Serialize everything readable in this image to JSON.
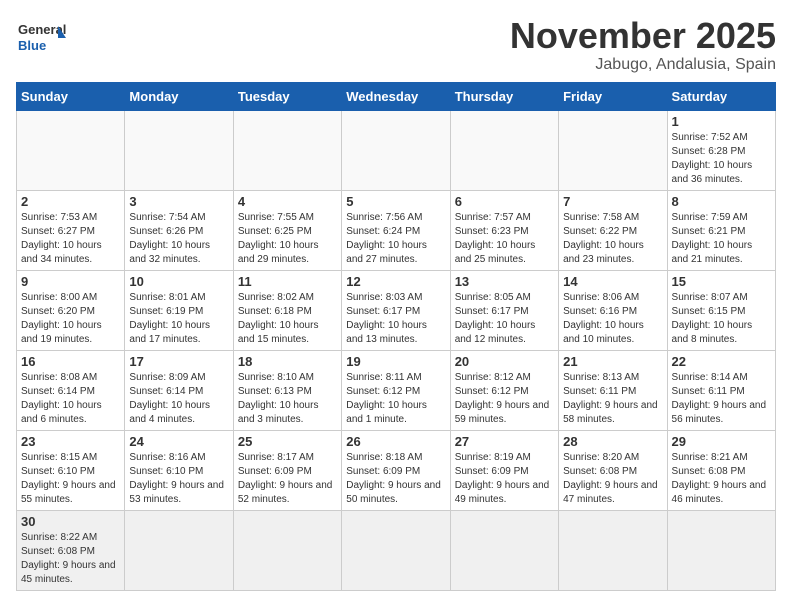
{
  "logo": {
    "general": "General",
    "blue": "Blue"
  },
  "title": "November 2025",
  "subtitle": "Jabugo, Andalusia, Spain",
  "days_header": [
    "Sunday",
    "Monday",
    "Tuesday",
    "Wednesday",
    "Thursday",
    "Friday",
    "Saturday"
  ],
  "weeks": [
    [
      {
        "num": "",
        "info": ""
      },
      {
        "num": "",
        "info": ""
      },
      {
        "num": "",
        "info": ""
      },
      {
        "num": "",
        "info": ""
      },
      {
        "num": "",
        "info": ""
      },
      {
        "num": "",
        "info": ""
      },
      {
        "num": "1",
        "info": "Sunrise: 7:52 AM\nSunset: 6:28 PM\nDaylight: 10 hours and 36 minutes."
      }
    ],
    [
      {
        "num": "2",
        "info": "Sunrise: 7:53 AM\nSunset: 6:27 PM\nDaylight: 10 hours and 34 minutes."
      },
      {
        "num": "3",
        "info": "Sunrise: 7:54 AM\nSunset: 6:26 PM\nDaylight: 10 hours and 32 minutes."
      },
      {
        "num": "4",
        "info": "Sunrise: 7:55 AM\nSunset: 6:25 PM\nDaylight: 10 hours and 29 minutes."
      },
      {
        "num": "5",
        "info": "Sunrise: 7:56 AM\nSunset: 6:24 PM\nDaylight: 10 hours and 27 minutes."
      },
      {
        "num": "6",
        "info": "Sunrise: 7:57 AM\nSunset: 6:23 PM\nDaylight: 10 hours and 25 minutes."
      },
      {
        "num": "7",
        "info": "Sunrise: 7:58 AM\nSunset: 6:22 PM\nDaylight: 10 hours and 23 minutes."
      },
      {
        "num": "8",
        "info": "Sunrise: 7:59 AM\nSunset: 6:21 PM\nDaylight: 10 hours and 21 minutes."
      }
    ],
    [
      {
        "num": "9",
        "info": "Sunrise: 8:00 AM\nSunset: 6:20 PM\nDaylight: 10 hours and 19 minutes."
      },
      {
        "num": "10",
        "info": "Sunrise: 8:01 AM\nSunset: 6:19 PM\nDaylight: 10 hours and 17 minutes."
      },
      {
        "num": "11",
        "info": "Sunrise: 8:02 AM\nSunset: 6:18 PM\nDaylight: 10 hours and 15 minutes."
      },
      {
        "num": "12",
        "info": "Sunrise: 8:03 AM\nSunset: 6:17 PM\nDaylight: 10 hours and 13 minutes."
      },
      {
        "num": "13",
        "info": "Sunrise: 8:05 AM\nSunset: 6:17 PM\nDaylight: 10 hours and 12 minutes."
      },
      {
        "num": "14",
        "info": "Sunrise: 8:06 AM\nSunset: 6:16 PM\nDaylight: 10 hours and 10 minutes."
      },
      {
        "num": "15",
        "info": "Sunrise: 8:07 AM\nSunset: 6:15 PM\nDaylight: 10 hours and 8 minutes."
      }
    ],
    [
      {
        "num": "16",
        "info": "Sunrise: 8:08 AM\nSunset: 6:14 PM\nDaylight: 10 hours and 6 minutes."
      },
      {
        "num": "17",
        "info": "Sunrise: 8:09 AM\nSunset: 6:14 PM\nDaylight: 10 hours and 4 minutes."
      },
      {
        "num": "18",
        "info": "Sunrise: 8:10 AM\nSunset: 6:13 PM\nDaylight: 10 hours and 3 minutes."
      },
      {
        "num": "19",
        "info": "Sunrise: 8:11 AM\nSunset: 6:12 PM\nDaylight: 10 hours and 1 minute."
      },
      {
        "num": "20",
        "info": "Sunrise: 8:12 AM\nSunset: 6:12 PM\nDaylight: 9 hours and 59 minutes."
      },
      {
        "num": "21",
        "info": "Sunrise: 8:13 AM\nSunset: 6:11 PM\nDaylight: 9 hours and 58 minutes."
      },
      {
        "num": "22",
        "info": "Sunrise: 8:14 AM\nSunset: 6:11 PM\nDaylight: 9 hours and 56 minutes."
      }
    ],
    [
      {
        "num": "23",
        "info": "Sunrise: 8:15 AM\nSunset: 6:10 PM\nDaylight: 9 hours and 55 minutes."
      },
      {
        "num": "24",
        "info": "Sunrise: 8:16 AM\nSunset: 6:10 PM\nDaylight: 9 hours and 53 minutes."
      },
      {
        "num": "25",
        "info": "Sunrise: 8:17 AM\nSunset: 6:09 PM\nDaylight: 9 hours and 52 minutes."
      },
      {
        "num": "26",
        "info": "Sunrise: 8:18 AM\nSunset: 6:09 PM\nDaylight: 9 hours and 50 minutes."
      },
      {
        "num": "27",
        "info": "Sunrise: 8:19 AM\nSunset: 6:09 PM\nDaylight: 9 hours and 49 minutes."
      },
      {
        "num": "28",
        "info": "Sunrise: 8:20 AM\nSunset: 6:08 PM\nDaylight: 9 hours and 47 minutes."
      },
      {
        "num": "29",
        "info": "Sunrise: 8:21 AM\nSunset: 6:08 PM\nDaylight: 9 hours and 46 minutes."
      }
    ],
    [
      {
        "num": "30",
        "info": "Sunrise: 8:22 AM\nSunset: 6:08 PM\nDaylight: 9 hours and 45 minutes."
      },
      {
        "num": "",
        "info": ""
      },
      {
        "num": "",
        "info": ""
      },
      {
        "num": "",
        "info": ""
      },
      {
        "num": "",
        "info": ""
      },
      {
        "num": "",
        "info": ""
      },
      {
        "num": "",
        "info": ""
      }
    ]
  ]
}
